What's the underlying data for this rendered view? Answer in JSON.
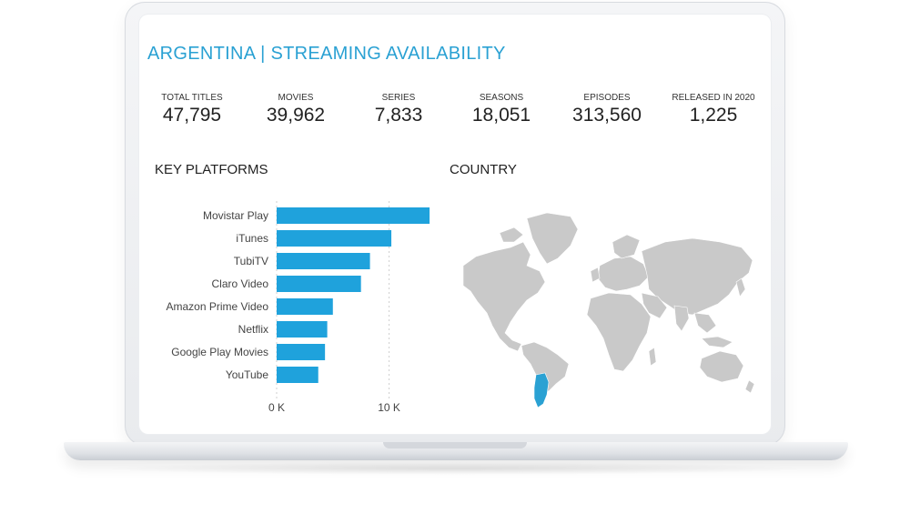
{
  "dashboard": {
    "title": "ARGENTINA | STREAMING AVAILABILITY",
    "kpis": [
      {
        "label": "TOTAL TITLES",
        "value": "47,795"
      },
      {
        "label": "MOVIES",
        "value": "39,962"
      },
      {
        "label": "SERIES",
        "value": "7,833"
      },
      {
        "label": "SEASONS",
        "value": "18,051"
      },
      {
        "label": "EPISODES",
        "value": "313,560"
      },
      {
        "label": "RELEASED IN 2020",
        "value": "1,225"
      }
    ],
    "platforms_title": "KEY PLATFORMS",
    "country_title": "COUNTRY"
  },
  "colors": {
    "accent": "#2aa1d3",
    "bar": "#1fa2dc",
    "map_land": "#c9c9c9",
    "map_highlight": "#2aa1d3"
  },
  "chart_data": {
    "type": "bar",
    "orientation": "horizontal",
    "categories": [
      "Movistar Play",
      "iTunes",
      "TubiTV",
      "Claro Video",
      "Amazon Prime Video",
      "Netflix",
      "Google Play Movies",
      "YouTube"
    ],
    "values": [
      13600,
      10200,
      8300,
      7500,
      5000,
      4500,
      4300,
      3700
    ],
    "xlim": [
      0,
      14000
    ],
    "xticks": [
      {
        "value": 0,
        "label": "0 K"
      },
      {
        "value": 10000,
        "label": "10 K"
      }
    ],
    "gridlines": "dashed vertical"
  },
  "map": {
    "highlighted_country": "Argentina"
  }
}
